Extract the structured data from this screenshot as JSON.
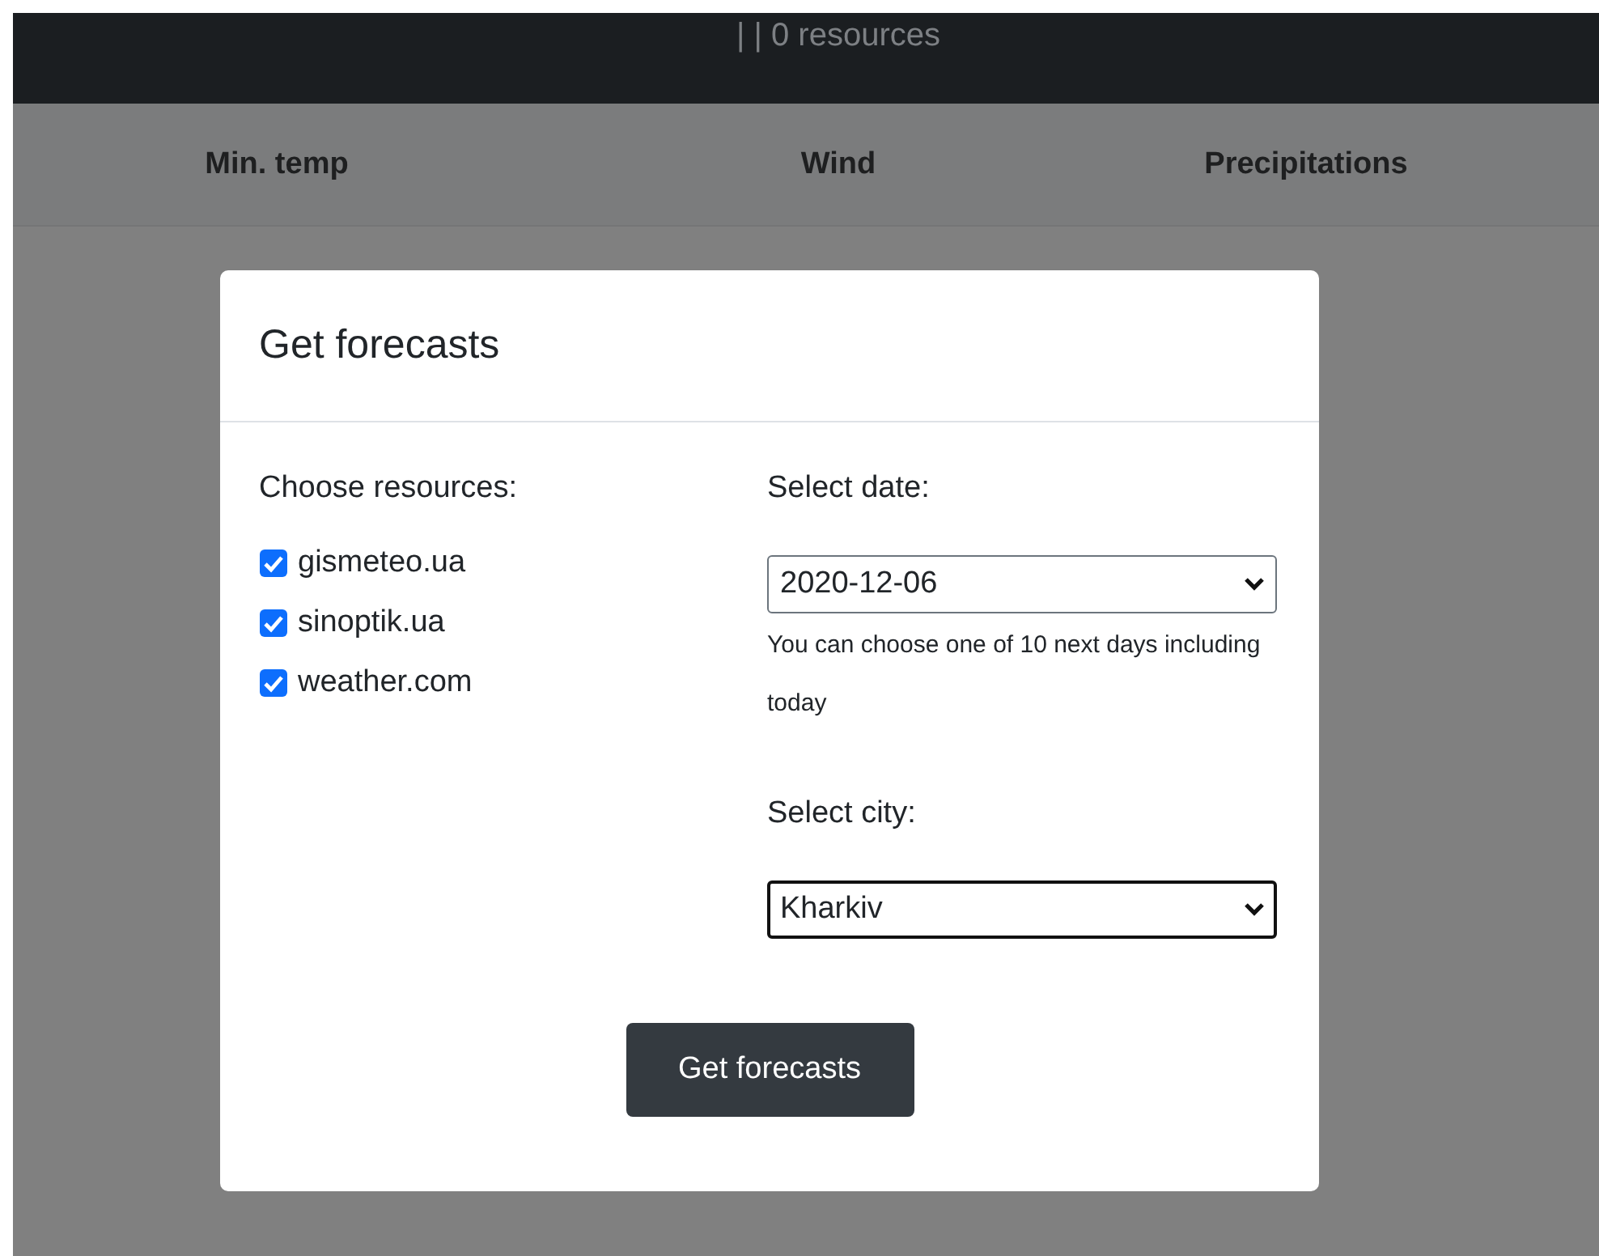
{
  "top_bar": {
    "status": "| | 0 resources"
  },
  "table": {
    "columns": [
      "Min. temp",
      "Wind",
      "Precipitations"
    ]
  },
  "modal": {
    "title": "Get forecasts",
    "resources": {
      "label": "Choose resources:",
      "items": [
        {
          "label": "gismeteo.ua",
          "checked": true
        },
        {
          "label": "sinoptik.ua",
          "checked": true
        },
        {
          "label": "weather.com",
          "checked": true
        }
      ]
    },
    "date": {
      "label": "Select date:",
      "value": "2020-12-06",
      "focused": false,
      "help": "You can choose one of 10 next days including today"
    },
    "city": {
      "label": "Select city:",
      "value": "Kharkiv",
      "focused": true
    },
    "button": "Get forecasts"
  }
}
